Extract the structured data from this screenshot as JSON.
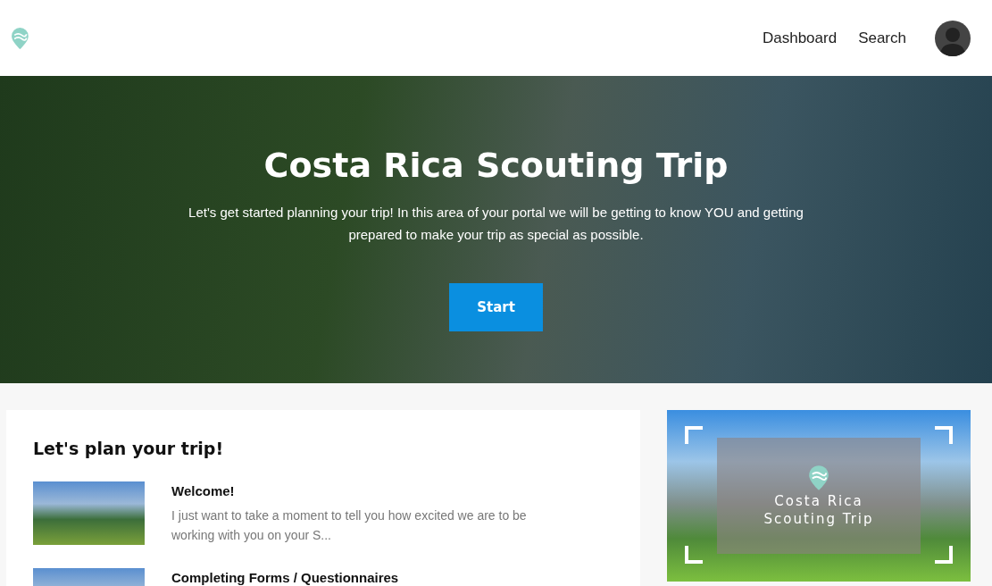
{
  "nav": {
    "links": [
      {
        "label": "Dashboard"
      },
      {
        "label": "Search"
      }
    ]
  },
  "hero": {
    "title": "Costa Rica Scouting Trip",
    "text": "Let's get started planning your trip! In this area of your portal we will be getting to know YOU and getting prepared to make your trip as special as possible.",
    "button": "Start"
  },
  "plan": {
    "heading": "Let's plan your trip!",
    "items": [
      {
        "title": "Welcome!",
        "excerpt": "I just want to take a moment to tell you how excited we are to be working with you on your S..."
      },
      {
        "title": "Completing Forms / Questionnaires"
      }
    ]
  },
  "promo": {
    "lines": [
      "Costa Rica",
      "Scouting Trip"
    ]
  }
}
